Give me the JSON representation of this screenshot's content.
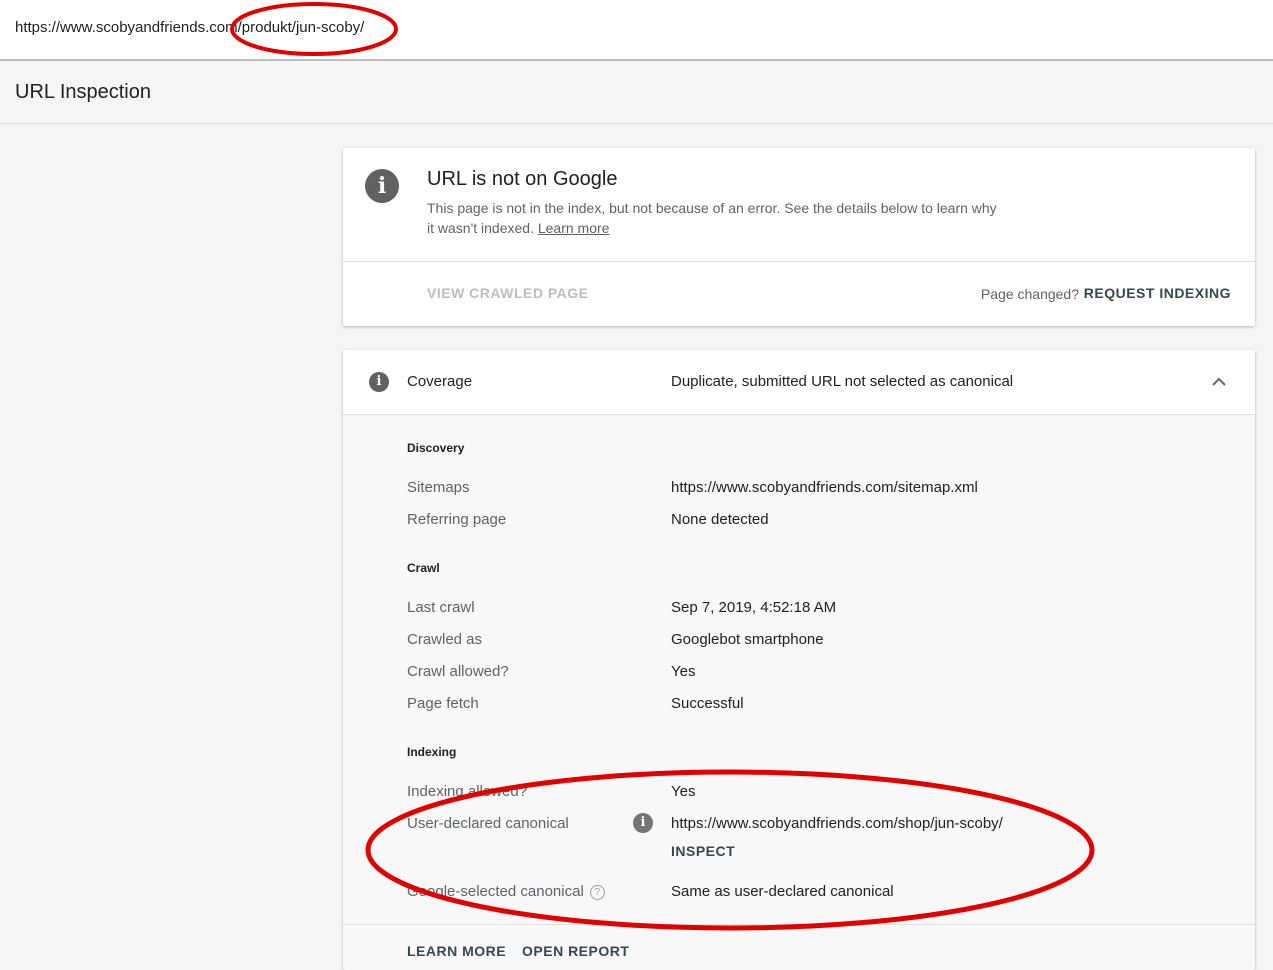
{
  "address_bar": {
    "url": "https://www.scobyandfriends.com/produkt/jun-scoby/"
  },
  "page": {
    "title": "URL Inspection"
  },
  "status_card": {
    "icon": "info-icon",
    "heading": "URL is not on Google",
    "description": "This page is not in the index, but not because of an error. See the details below to learn why it wasn't indexed.",
    "learn_more": "Learn more",
    "view_crawled_page": "VIEW CRAWLED PAGE",
    "page_changed": "Page changed?",
    "request_indexing": "REQUEST INDEXING"
  },
  "coverage": {
    "label": "Coverage",
    "value": "Duplicate, submitted URL not selected as canonical",
    "discovery": {
      "heading": "Discovery",
      "rows": [
        {
          "label": "Sitemaps",
          "value": "https://www.scobyandfriends.com/sitemap.xml"
        },
        {
          "label": "Referring page",
          "value": "None detected"
        }
      ]
    },
    "crawl": {
      "heading": "Crawl",
      "rows": [
        {
          "label": "Last crawl",
          "value": "Sep 7, 2019, 4:52:18 AM"
        },
        {
          "label": "Crawled as",
          "value": "Googlebot smartphone"
        },
        {
          "label": "Crawl allowed?",
          "value": "Yes"
        },
        {
          "label": "Page fetch",
          "value": "Successful"
        }
      ]
    },
    "indexing": {
      "heading": "Indexing",
      "rows": [
        {
          "label": "Indexing allowed?",
          "value": "Yes"
        },
        {
          "label": "User-declared canonical",
          "value": "https://www.scobyandfriends.com/shop/jun-scoby/"
        },
        {
          "label": "Google-selected canonical",
          "value": "Same as user-declared canonical"
        }
      ],
      "inspect": "INSPECT"
    },
    "footer": {
      "learn_more": "LEARN MORE",
      "open_report": "OPEN REPORT"
    }
  },
  "annotation": {
    "color": "#e00000"
  }
}
